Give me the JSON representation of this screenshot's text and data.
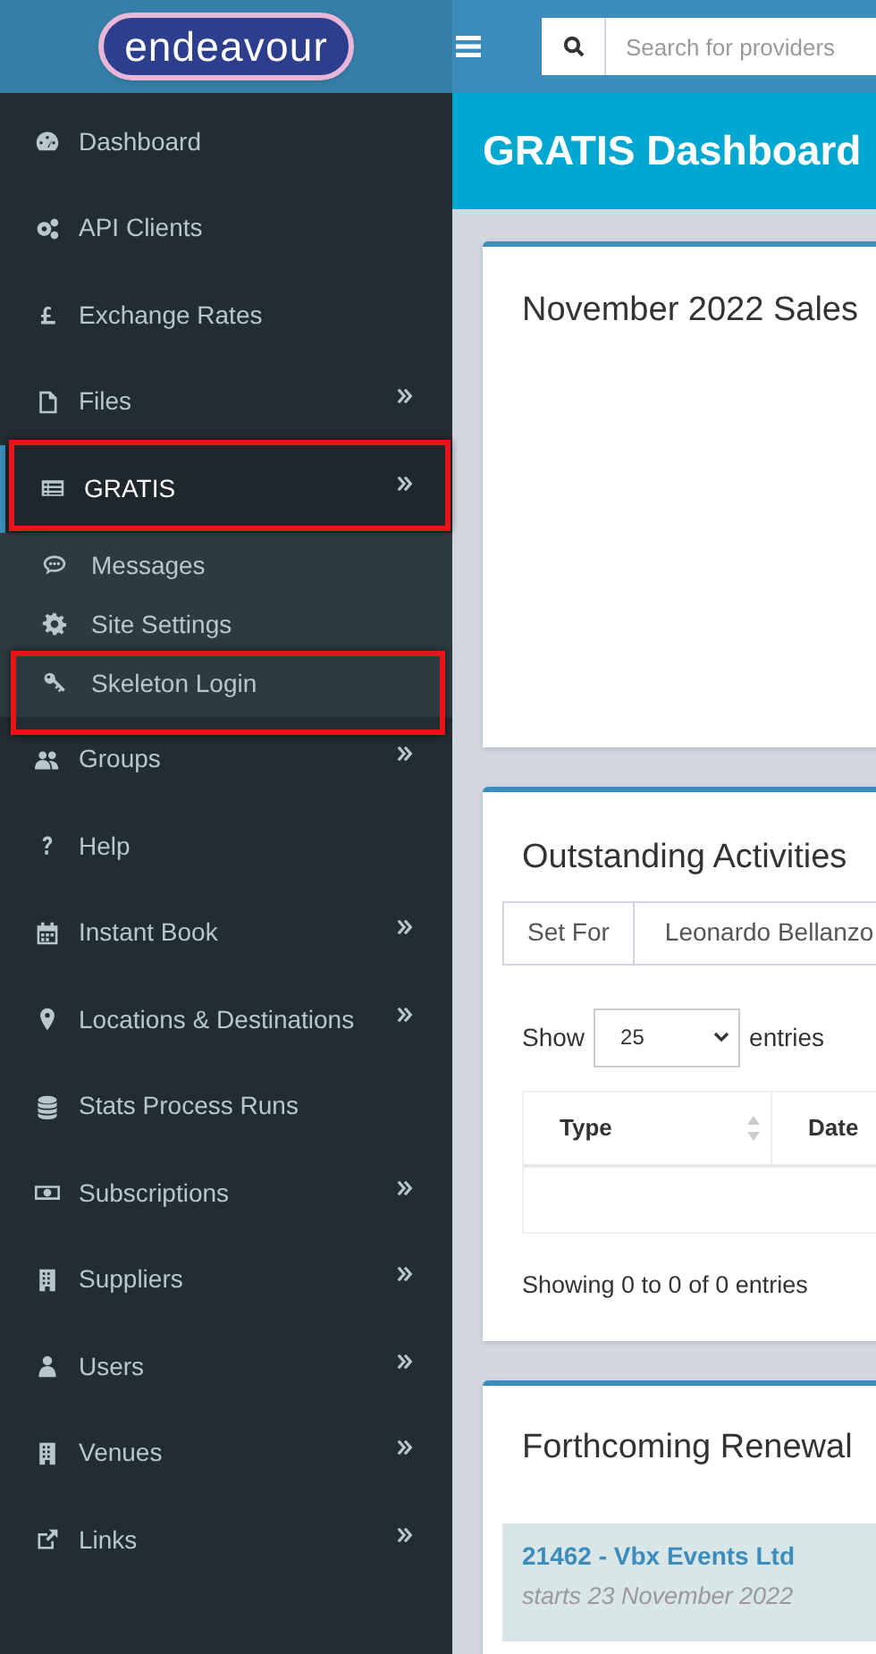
{
  "logo": {
    "text": "endeavour"
  },
  "search": {
    "placeholder": "Search for providers"
  },
  "sidebar": {
    "items": [
      {
        "label": "Dashboard",
        "selected": false,
        "has_arrow": false
      },
      {
        "label": "API Clients",
        "selected": false,
        "has_arrow": false
      },
      {
        "label": "Exchange Rates",
        "selected": false,
        "has_arrow": false
      },
      {
        "label": "Files",
        "selected": false,
        "has_arrow": true
      },
      {
        "label": "GRATIS",
        "selected": true,
        "has_arrow": true,
        "highlighted": true,
        "expanded": true,
        "children": [
          {
            "label": "Messages",
            "highlighted": false
          },
          {
            "label": "Site Settings",
            "highlighted": false
          },
          {
            "label": "Skeleton Login",
            "highlighted": true
          }
        ]
      },
      {
        "label": "Groups",
        "selected": false,
        "has_arrow": true
      },
      {
        "label": "Help",
        "selected": false,
        "has_arrow": false
      },
      {
        "label": "Instant Book",
        "selected": false,
        "has_arrow": true
      },
      {
        "label": "Locations & Destinations",
        "selected": false,
        "has_arrow": true
      },
      {
        "label": "Stats Process Runs",
        "selected": false,
        "has_arrow": false
      },
      {
        "label": "Subscriptions",
        "selected": false,
        "has_arrow": true
      },
      {
        "label": "Suppliers",
        "selected": false,
        "has_arrow": true
      },
      {
        "label": "Users",
        "selected": false,
        "has_arrow": true
      },
      {
        "label": "Venues",
        "selected": false,
        "has_arrow": true
      },
      {
        "label": "Links",
        "selected": false,
        "has_arrow": true
      }
    ]
  },
  "page_title": "GRATIS Dashboard",
  "sales_card": {
    "title": "November 2022 Sales"
  },
  "activities_card": {
    "title": "Outstanding Activities",
    "set_for_label": "Set For",
    "set_for_value": "Leonardo Bellanzo",
    "show_label": "Show",
    "page_size": "25",
    "entries_label": "entries",
    "columns": [
      {
        "label": "Type",
        "sortable": true
      },
      {
        "label": "Date",
        "sortable": false
      }
    ],
    "info": "Showing 0 to 0 of 0 entries"
  },
  "renewals_card": {
    "title": "Forthcoming Renewal",
    "items": [
      {
        "link": "21462 - Vbx Events Ltd",
        "starts": "starts 23 November 2022"
      }
    ]
  }
}
